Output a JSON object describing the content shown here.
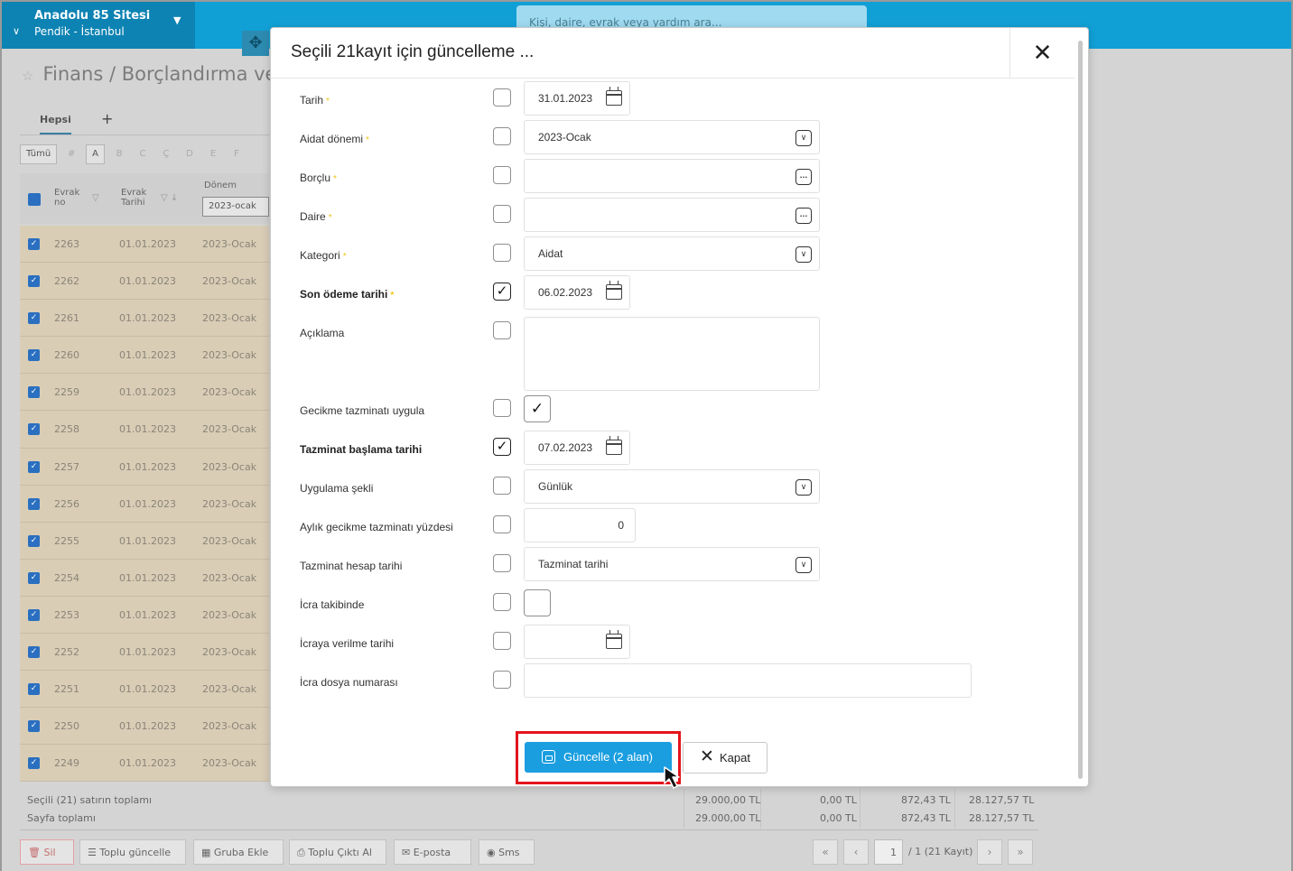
{
  "header": {
    "site_name": "Anadolu 85 Sitesi",
    "site_location": "Pendik - İstanbul",
    "search_placeholder": "Kişi, daire, evrak veya yardım ara..."
  },
  "page": {
    "breadcrumb": "Finans / Borçlandırma ve",
    "tab_all": "Hepsi",
    "tab_add": "+",
    "letters": [
      "Tümü",
      "#",
      "A",
      "B",
      "C",
      "Ç",
      "D",
      "E",
      "F"
    ],
    "columns": {
      "evrak_no": "Evrak no",
      "evrak_tarihi": "Evrak Tarihi",
      "donem": "Dönem",
      "donem_filter": "2023-ocak"
    },
    "rows": [
      {
        "no": "2263",
        "date": "01.01.2023",
        "period": "2023-Ocak"
      },
      {
        "no": "2262",
        "date": "01.01.2023",
        "period": "2023-Ocak"
      },
      {
        "no": "2261",
        "date": "01.01.2023",
        "period": "2023-Ocak"
      },
      {
        "no": "2260",
        "date": "01.01.2023",
        "period": "2023-Ocak"
      },
      {
        "no": "2259",
        "date": "01.01.2023",
        "period": "2023-Ocak"
      },
      {
        "no": "2258",
        "date": "01.01.2023",
        "period": "2023-Ocak"
      },
      {
        "no": "2257",
        "date": "01.01.2023",
        "period": "2023-Ocak"
      },
      {
        "no": "2256",
        "date": "01.01.2023",
        "period": "2023-Ocak"
      },
      {
        "no": "2255",
        "date": "01.01.2023",
        "period": "2023-Ocak"
      },
      {
        "no": "2254",
        "date": "01.01.2023",
        "period": "2023-Ocak"
      },
      {
        "no": "2253",
        "date": "01.01.2023",
        "period": "2023-Ocak"
      },
      {
        "no": "2252",
        "date": "01.01.2023",
        "period": "2023-Ocak"
      },
      {
        "no": "2251",
        "date": "01.01.2023",
        "period": "2023-Ocak"
      },
      {
        "no": "2250",
        "date": "01.01.2023",
        "period": "2023-Ocak"
      },
      {
        "no": "2249",
        "date": "01.01.2023",
        "period": "2023-Ocak"
      }
    ],
    "totals": {
      "selected_label": "Seçili (21) satırın toplamı",
      "page_label": "Sayfa toplamı",
      "selected": [
        "29.000,00 TL",
        "0,00 TL",
        "872,43 TL",
        "28.127,57 TL"
      ],
      "page": [
        "29.000,00 TL",
        "0,00 TL",
        "872,43 TL",
        "28.127,57 TL"
      ]
    },
    "footer_buttons": {
      "delete": "Sil",
      "bulk_update": "Toplu güncelle",
      "add_group": "Gruba Ekle",
      "bulk_print": "Toplu Çıktı Al",
      "email": "E-posta",
      "sms": "Sms"
    },
    "pager": {
      "current": "1",
      "info": "/ 1 (21 Kayıt)"
    }
  },
  "modal": {
    "title": "Seçili 21kayıt için güncelleme ...",
    "fields": {
      "tarih": {
        "label": "Tarih",
        "value": "31.01.2023",
        "checked": false
      },
      "aidat_donemi": {
        "label": "Aidat dönemi",
        "value": "2023-Ocak",
        "checked": false
      },
      "borclu": {
        "label": "Borçlu",
        "value": "",
        "checked": false
      },
      "daire": {
        "label": "Daire",
        "value": "",
        "checked": false
      },
      "kategori": {
        "label": "Kategori",
        "value": "Aidat",
        "checked": false
      },
      "son_odeme": {
        "label": "Son ödeme tarihi",
        "value": "06.02.2023",
        "checked": true
      },
      "aciklama": {
        "label": "Açıklama",
        "value": "",
        "checked": false
      },
      "gecikme": {
        "label": "Gecikme tazminatı uygula",
        "value": true,
        "checked": false
      },
      "tazminat_baslama": {
        "label": "Tazminat başlama tarihi",
        "value": "07.02.2023",
        "checked": true
      },
      "uygulama_sekli": {
        "label": "Uygulama şekli",
        "value": "Günlük",
        "checked": false
      },
      "yuzde": {
        "label": "Aylık gecikme tazminatı yüzdesi",
        "value": "0",
        "checked": false
      },
      "hesap_tarihi": {
        "label": "Tazminat hesap tarihi",
        "value": "Tazminat tarihi",
        "checked": false
      },
      "icra_takibinde": {
        "label": "İcra takibinde",
        "value": false,
        "checked": false
      },
      "icraya_verilme": {
        "label": "İcraya verilme tarihi",
        "value": "",
        "checked": false
      },
      "icra_dosya": {
        "label": "İcra dosya numarası",
        "value": "",
        "checked": false
      }
    },
    "update_button": "Güncelle (2 alan)",
    "close_button": "Kapat"
  },
  "colors": {
    "accent": "#1a9ee0",
    "header": "#11a0d6",
    "highlight": "#e3141c",
    "required": "#f0c419"
  }
}
